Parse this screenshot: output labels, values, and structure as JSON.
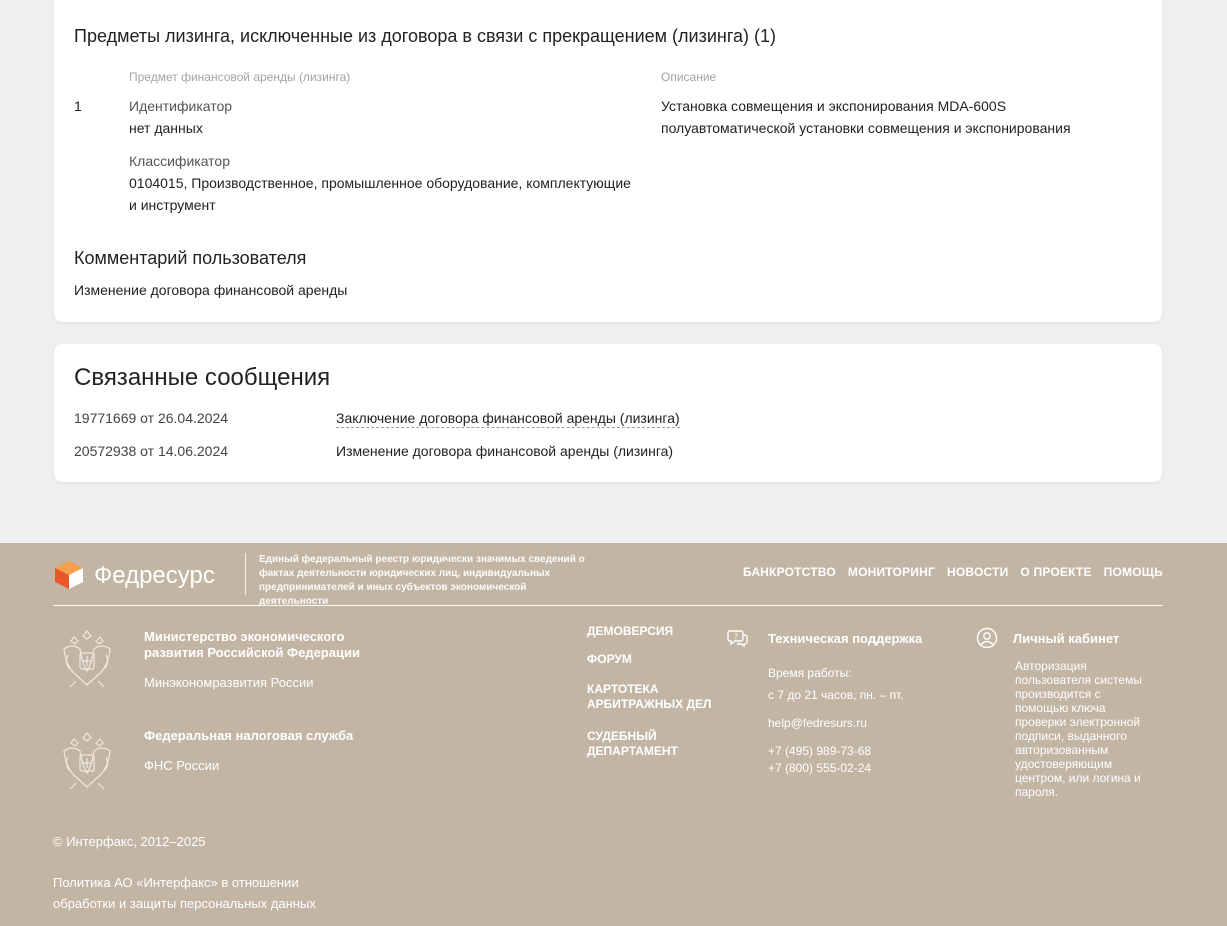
{
  "excluded": {
    "title": "Предметы лизинга, исключенные из договора в связи с прекращением (лизинга) (1)",
    "col_subject": "Предмет финансовой аренды (лизинга)",
    "col_description": "Описание",
    "row": {
      "num": "1",
      "id_label": "Идентификатор",
      "id_value": "нет данных",
      "class_label": "Классификатор",
      "class_value_line1": "0104015, Производственное, промышленное оборудование, комплектующие",
      "class_value_line2": "и инструмент",
      "desc_line1": "Установка совмещения и экспонирования MDA-600S",
      "desc_line2": "полуавтоматической установки совмещения и экспонирования"
    },
    "comment_title": "Комментарий пользователя",
    "comment_text": "Изменение договора финансовой аренды"
  },
  "related": {
    "title": "Связанные сообщения",
    "items": [
      {
        "num": "19771669 от 26.04.2024",
        "label": "Заключение договора финансовой аренды (лизинга)"
      },
      {
        "num": "20572938 от 14.06.2024",
        "label": "Изменение договора финансовой аренды (лизинга)"
      }
    ]
  },
  "footer": {
    "brand": "Федресурс",
    "tagline": "Единый федеральный реестр юридически значимых сведений о фактах деятельности юридических лиц, индивидуальных предпринимателей и иных субъектов экономической деятельности",
    "nav": [
      "БАНКРОТСТВО",
      "МОНИТОРИНГ",
      "НОВОСТИ",
      "О ПРОЕКТЕ",
      "ПОМОЩЬ"
    ],
    "orgs": [
      {
        "name_line1": "Министерство экономического",
        "name_line2": "развития Российской Федерации",
        "short": "Минэкономразвития России"
      },
      {
        "name_line1": "Федеральная налоговая служба",
        "name_line2": "",
        "short": "ФНС России"
      }
    ],
    "links": [
      {
        "line1": "ДЕМОВЕРСИЯ",
        "line2": ""
      },
      {
        "line1": "ФОРУМ",
        "line2": ""
      },
      {
        "line1": "КАРТОТЕКА",
        "line2": "АРБИТРАЖНЫХ ДЕЛ"
      },
      {
        "line1": "СУДЕБНЫЙ",
        "line2": "ДЕПАРТАМЕНТ"
      }
    ],
    "support": {
      "title": "Техническая поддержка",
      "hours_label": "Время работы:",
      "hours": "с 7 до 21 часов, пн. – пт.",
      "email": "help@fedresurs.ru",
      "phone1": "+7 (495) 989-73-68",
      "phone2": "+7 (800) 555-02-24"
    },
    "cabinet": {
      "title": "Личный кабинет",
      "text": "Авторизация пользователя системы производится с помощью ключа проверки электронной подписи, выданного авторизованным удостоверяющим центром, или логина и пароля."
    },
    "copyright": "© Интерфакс, 2012–2025",
    "policy": "Политика АО «Интерфакс» в отношении обработки и защиты персональных данных"
  }
}
